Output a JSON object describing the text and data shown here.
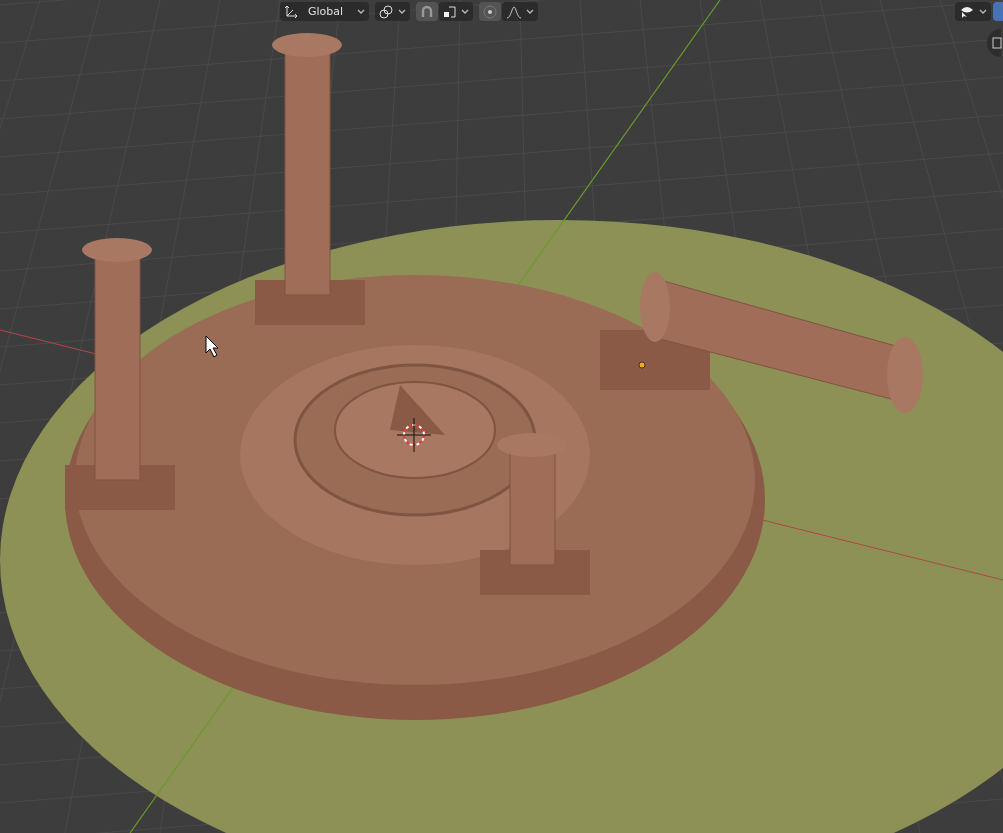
{
  "header": {
    "transform_orientation": {
      "label": "Global"
    },
    "snap": {
      "on": false
    },
    "proportional_editing": {
      "on": false
    }
  },
  "viewport": {
    "show_cursor": true
  }
}
